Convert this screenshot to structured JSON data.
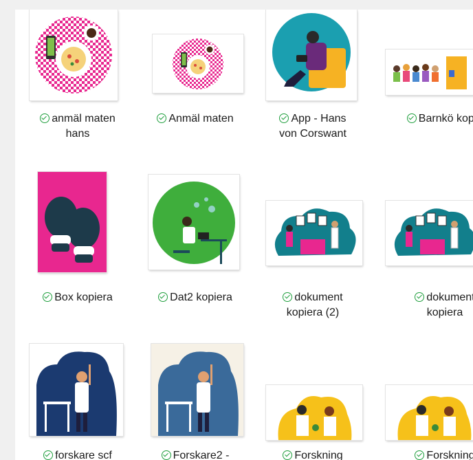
{
  "files": [
    {
      "id": "anmal-maten-hans",
      "lines": [
        "anmäl maten",
        "hans"
      ],
      "icon": "synced-check-icon"
    },
    {
      "id": "anmal-maten",
      "lines": [
        "Anmäl maten"
      ],
      "icon": "synced-check-icon"
    },
    {
      "id": "app-hans",
      "lines": [
        "App - Hans",
        "von Corswant"
      ],
      "icon": "synced-check-icon"
    },
    {
      "id": "barnko-kopiera",
      "lines": [
        "Barnkö kopie"
      ],
      "icon": "synced-check-icon"
    },
    {
      "id": "box-kopiera",
      "lines": [
        "Box kopiera"
      ],
      "icon": "synced-check-icon"
    },
    {
      "id": "dat2-kopiera",
      "lines": [
        "Dat2 kopiera"
      ],
      "icon": "synced-check-icon"
    },
    {
      "id": "dokument-kopiera-2",
      "lines": [
        "dokument",
        "kopiera (2)"
      ],
      "icon": "synced-check-icon"
    },
    {
      "id": "dokument-kopiera",
      "lines": [
        "dokument",
        "kopiera"
      ],
      "icon": "synced-check-icon"
    },
    {
      "id": "forskare-scf",
      "lines": [
        "forskare scf"
      ],
      "icon": "synced-check-icon"
    },
    {
      "id": "forskare2",
      "lines": [
        "Forskare2 -"
      ],
      "icon": "synced-check-icon"
    },
    {
      "id": "forskning-1",
      "lines": [
        "Forskning"
      ],
      "icon": "synced-check-icon"
    },
    {
      "id": "forskning-2",
      "lines": [
        "Forskning"
      ],
      "icon": "synced-check-icon"
    }
  ],
  "colors": {
    "status_green": "#1e9e3c",
    "pane_bg": "#ffffff",
    "window_bg": "#f0f0f0"
  }
}
